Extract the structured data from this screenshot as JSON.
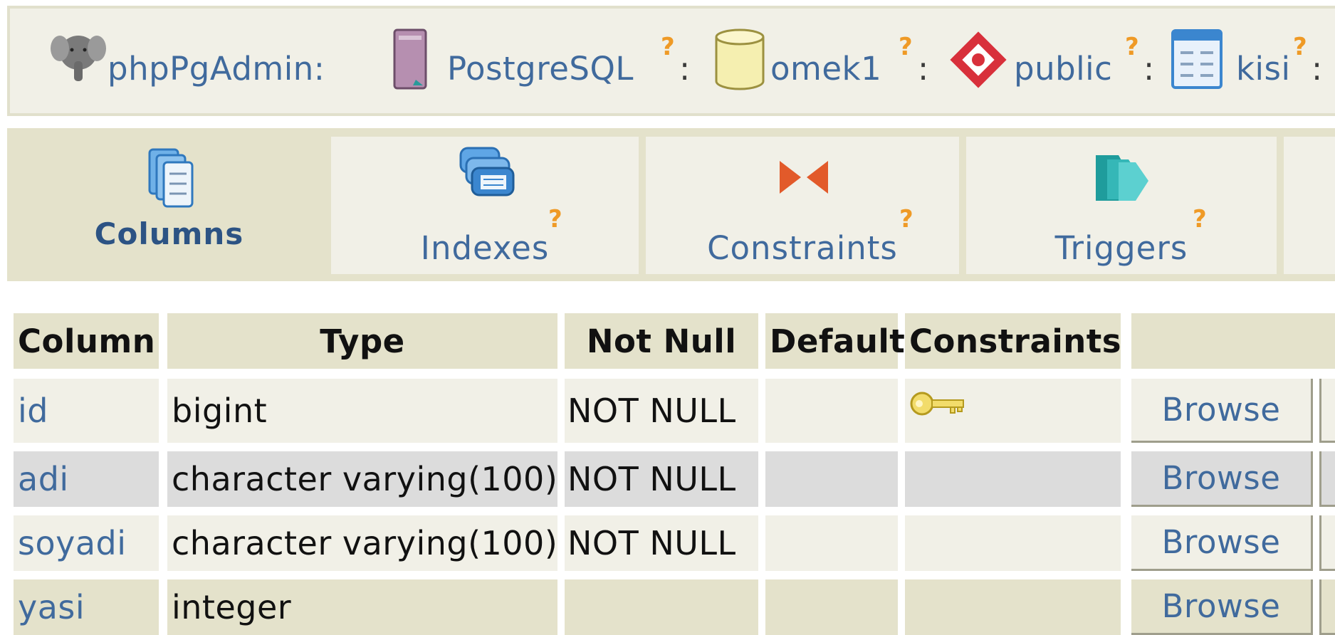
{
  "breadcrumb": {
    "items": [
      {
        "label": "phpPgAdmin:",
        "icon": "elephant-icon"
      },
      {
        "label": "PostgreSQL",
        "icon": "server-icon",
        "help": "?",
        "sep": ":"
      },
      {
        "label": "omek1",
        "icon": "database-icon",
        "help": "?",
        "sep": ":"
      },
      {
        "label": "public",
        "icon": "schema-icon",
        "help": "?",
        "sep": ":"
      },
      {
        "label": "kisi",
        "icon": "table-icon",
        "help": "?",
        "sep": ":"
      }
    ]
  },
  "tabs": [
    {
      "label": "Columns",
      "icon": "columns-icon",
      "active": true
    },
    {
      "label": "Indexes",
      "icon": "indexes-icon",
      "help": "?"
    },
    {
      "label": "Constraints",
      "icon": "constraints-icon",
      "help": "?"
    },
    {
      "label": "Triggers",
      "icon": "triggers-icon",
      "help": "?"
    }
  ],
  "table": {
    "headers": [
      "Column",
      "Type",
      "Not Null",
      "Default",
      "Constraints"
    ],
    "rows": [
      {
        "column": "id",
        "type": "bigint",
        "not_null": "NOT NULL",
        "default": "",
        "constraint_icon": "primary-key-icon",
        "action": "Browse"
      },
      {
        "column": "adi",
        "type": "character varying(100)",
        "not_null": "NOT NULL",
        "default": "",
        "action": "Browse"
      },
      {
        "column": "soyadi",
        "type": "character varying(100)",
        "not_null": "NOT NULL",
        "default": "",
        "action": "Browse"
      },
      {
        "column": "yasi",
        "type": "integer",
        "not_null": "",
        "default": "",
        "action": "Browse"
      }
    ]
  },
  "colors": {
    "link": "#406a9d",
    "help": "#ef9a26",
    "panel": "#f1f0e7",
    "panel_dark": "#e4e2cb"
  }
}
